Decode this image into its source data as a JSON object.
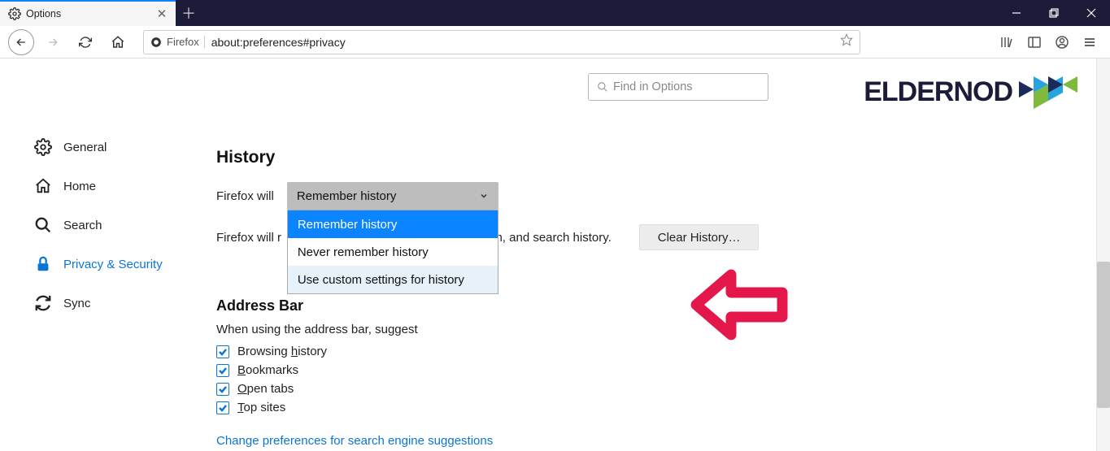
{
  "tab": {
    "title": "Options"
  },
  "urlbar": {
    "identity": "Firefox",
    "url": "about:preferences#privacy"
  },
  "find": {
    "placeholder": "Find in Options"
  },
  "sidebar": {
    "items": [
      {
        "label": "General"
      },
      {
        "label": "Home"
      },
      {
        "label": "Search"
      },
      {
        "label": "Privacy & Security"
      },
      {
        "label": "Sync"
      }
    ]
  },
  "history": {
    "title": "History",
    "label": "Firefox will",
    "selected": "Remember history",
    "options": [
      "Remember history",
      "Never remember history",
      "Use custom settings for history"
    ],
    "caption_prefix": "Firefox will r",
    "caption_suffix": "m, and search history.",
    "clear_button": "Clear History…"
  },
  "addressbar": {
    "title": "Address Bar",
    "caption": "When using the address bar, suggest",
    "opts": [
      {
        "pre": "Browsing ",
        "key": "h",
        "post": "istory"
      },
      {
        "pre": "",
        "key": "B",
        "post": "ookmarks"
      },
      {
        "pre": "",
        "key": "O",
        "post": "pen tabs"
      },
      {
        "pre": "",
        "key": "T",
        "post": "op sites"
      }
    ],
    "link": "Change preferences for search engine suggestions"
  },
  "logo": {
    "text1": "ELDER",
    "text2": "NOD"
  }
}
